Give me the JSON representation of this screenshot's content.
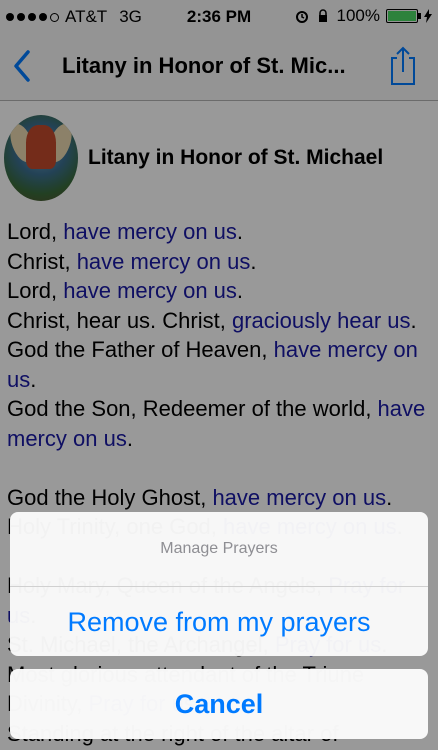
{
  "status": {
    "carrier": "AT&T",
    "network": "3G",
    "time": "2:36 PM",
    "battery": "100%"
  },
  "nav": {
    "title": "Litany in Honor of St. Mic..."
  },
  "header": {
    "title": "Litany in Honor of St. Michael"
  },
  "litany": [
    {
      "plain": "Lord, ",
      "blue": "have mercy on us",
      "tail": "."
    },
    {
      "plain": "Christ, ",
      "blue": "have mercy on us",
      "tail": "."
    },
    {
      "plain": "Lord, ",
      "blue": "have mercy on us",
      "tail": "."
    },
    {
      "plain": "Christ, hear us. Christ, ",
      "blue": "graciously hear us",
      "tail": "."
    },
    {
      "plain": "God the Father of Heaven, ",
      "blue": "have mercy on us",
      "tail": "."
    },
    {
      "plain": "God the Son, Redeemer of the world, ",
      "blue": "have mercy on us",
      "tail": "."
    },
    {
      "plain": "",
      "blue": "",
      "tail": ""
    },
    {
      "plain": "God the Holy Ghost, ",
      "blue": "have mercy on us",
      "tail": "."
    },
    {
      "plain": "Holy Trinity, one God, ",
      "blue": "have mercy on us",
      "tail": "."
    },
    {
      "plain": "",
      "blue": "",
      "tail": ""
    },
    {
      "plain": "Holy Mary, Queen of the Angels, ",
      "blue": "Pray for us",
      "tail": "."
    },
    {
      "plain": "St. Michael, the Archangel, ",
      "blue": "Pray for us",
      "tail": "."
    },
    {
      "plain": "Most glorious attendant of the Triune Divinity, ",
      "blue": "Pray for us",
      "tail": "."
    },
    {
      "plain": "Standing at the right of the altar of",
      "blue": "",
      "tail": ""
    }
  ],
  "sheet": {
    "title": "Manage Prayers",
    "action": "Remove from my prayers",
    "cancel": "Cancel"
  },
  "colors": {
    "link_blue": "#1a1aa6",
    "ios_blue": "#007aff",
    "battery_green": "#4cd964"
  },
  "icons": [
    "back-chevron-icon",
    "share-icon",
    "alarm-icon",
    "lock-rotation-icon",
    "charging-icon"
  ]
}
